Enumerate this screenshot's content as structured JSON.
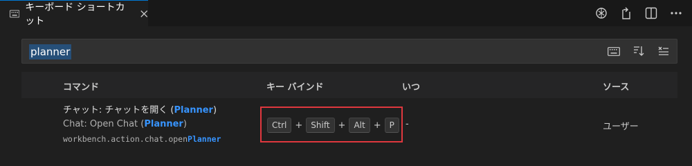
{
  "tab": {
    "title": "キーボード ショートカット",
    "icon": "keyboard-icon",
    "close_icon": "close-icon"
  },
  "actions": [
    "openai-icon",
    "open-json-icon",
    "split-editor-icon",
    "more-icon"
  ],
  "search": {
    "value": "planner",
    "icons": [
      "keyboard-icon",
      "sort-icon",
      "clear-filter-icon"
    ]
  },
  "columns": {
    "command": "コマンド",
    "keybinding": "キー バインド",
    "when": "いつ",
    "source": "ソース"
  },
  "row": {
    "line1_prefix": "チャット: チャットを開く (",
    "line1_highlight": "Planner",
    "line1_suffix": ")",
    "line2_prefix": "Chat: Open Chat (",
    "line2_highlight": "Planner",
    "line2_suffix": ")",
    "line3_prefix": "workbench.action.chat.open",
    "line3_highlight": "Planner",
    "keys": [
      "Ctrl",
      "Shift",
      "Alt",
      "P"
    ],
    "plus": "+",
    "when": "-",
    "source": "ユーザー"
  },
  "colors": {
    "accent": "#0078d4",
    "highlight": "#3794ff",
    "selection_box": "#e0383e"
  }
}
